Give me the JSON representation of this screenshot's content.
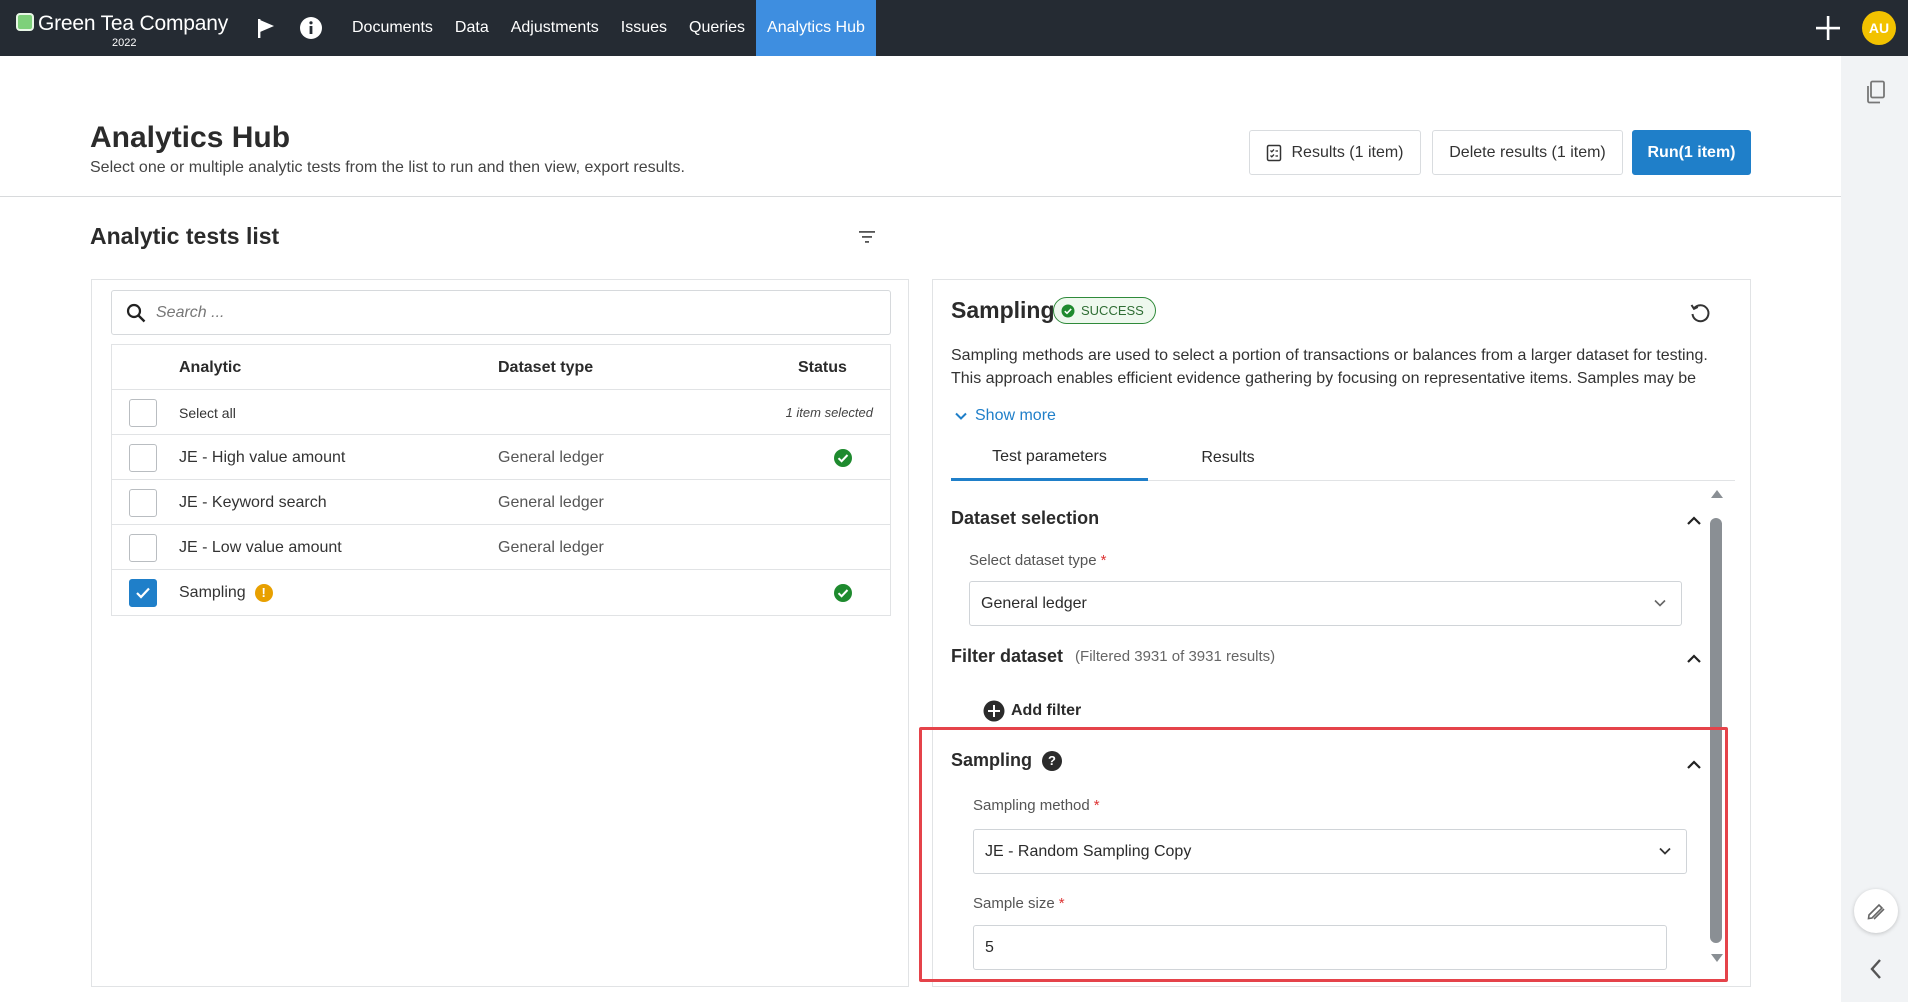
{
  "brand": {
    "name": "Green Tea Company",
    "year": "2022"
  },
  "nav": {
    "items": [
      {
        "label": "Documents"
      },
      {
        "label": "Data"
      },
      {
        "label": "Adjustments"
      },
      {
        "label": "Issues"
      },
      {
        "label": "Queries"
      },
      {
        "label": "Analytics Hub"
      }
    ],
    "active": "Analytics Hub",
    "icons": [
      "flag-icon",
      "info-icon",
      "plus-icon"
    ],
    "avatar_initials": "AU"
  },
  "header": {
    "title": "Analytics Hub",
    "subtitle": "Select one or multiple analytic tests from the list to run and then view, export results.",
    "buttons": {
      "results": "Results (1 item)",
      "delete": "Delete results (1 item)",
      "run": "Run(1 item)"
    }
  },
  "list": {
    "title": "Analytic tests list",
    "search_placeholder": "Search ...",
    "columns": {
      "analytic": "Analytic",
      "dataset_type": "Dataset type",
      "status": "Status"
    },
    "select_all": "Select all",
    "selected_count": "1 item selected",
    "rows": [
      {
        "name": "JE - High value amount",
        "dataset_type": "General ledger",
        "checked": false,
        "status": "success"
      },
      {
        "name": "JE - Keyword search",
        "dataset_type": "General ledger",
        "checked": false,
        "status": ""
      },
      {
        "name": "JE - Low value amount",
        "dataset_type": "General ledger",
        "checked": false,
        "status": ""
      },
      {
        "name": "Sampling",
        "dataset_type": "",
        "checked": true,
        "status": "success",
        "warning": "!"
      }
    ]
  },
  "detail": {
    "title": "Sampling",
    "status_badge": "SUCCESS",
    "description": "Sampling methods are used to select a portion of transactions or balances from a larger dataset for testing. This approach enables efficient evidence gathering by focusing on representative items. Samples may be chosen...",
    "show_more": "Show more",
    "tabs": [
      "Test parameters",
      "Results"
    ],
    "dataset_selection": {
      "title": "Dataset selection",
      "label": "Select dataset type",
      "value": "General ledger"
    },
    "filter_dataset": {
      "title": "Filter dataset",
      "meta": "(Filtered 3931 of 3931 results)",
      "add_filter": "Add filter"
    },
    "sampling": {
      "title": "Sampling",
      "help": "?",
      "method_label": "Sampling method",
      "method_value": "JE - Random Sampling Copy",
      "size_label": "Sample size",
      "size_value": "5"
    },
    "required_marker": "*"
  },
  "colors": {
    "nav_bg": "#252b33",
    "accent": "#1f7fc9",
    "nav_active": "#3e8ee0",
    "success": "#1e8a2e",
    "warning": "#e8a000",
    "highlight": "#e5434a",
    "avatar": "#f2c200"
  }
}
